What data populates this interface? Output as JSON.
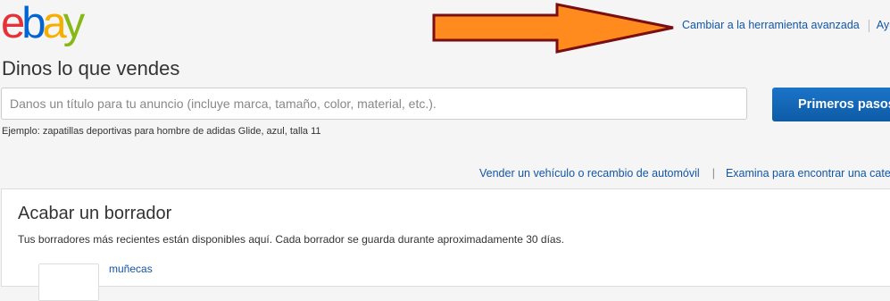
{
  "logo": {
    "text": "ebay",
    "letters": [
      {
        "char": "e",
        "color": "#e53238"
      },
      {
        "char": "b",
        "color": "#0064d2"
      },
      {
        "char": "a",
        "color": "#f5af02"
      },
      {
        "char": "y",
        "color": "#86b817"
      }
    ]
  },
  "header": {
    "advanced_tool_link": "Cambiar a la herramienta avanzada",
    "help_link": "Ayu"
  },
  "annotation": {
    "arrow_fill": "#ff8a1e",
    "arrow_stroke": "#7a0f12"
  },
  "listing": {
    "heading": "Dinos lo que vendes",
    "title_placeholder": "Danos un título para tu anuncio (incluye marca, tamaño, color, material, etc.).",
    "title_value": "",
    "start_button": "Primeros pasos",
    "example_text": "Ejemplo: zapatillas deportivas para hombre de adidas Glide, azul, talla 11"
  },
  "secondary_links": {
    "vehicle_link": "Vender un vehículo o recambio de automóvil",
    "separator": "|",
    "browse_link": "Examina para encontrar una categ"
  },
  "drafts": {
    "heading": "Acabar un borrador",
    "description": "Tus borradores más recientes están disponibles aquí. Cada borrador se guarda durante aproximadamente 30 días.",
    "items": [
      {
        "title": "muñecas"
      }
    ]
  },
  "colors": {
    "link": "#1256a8",
    "primary_button": "#0d5ba6",
    "background": "#f5f5f5"
  }
}
